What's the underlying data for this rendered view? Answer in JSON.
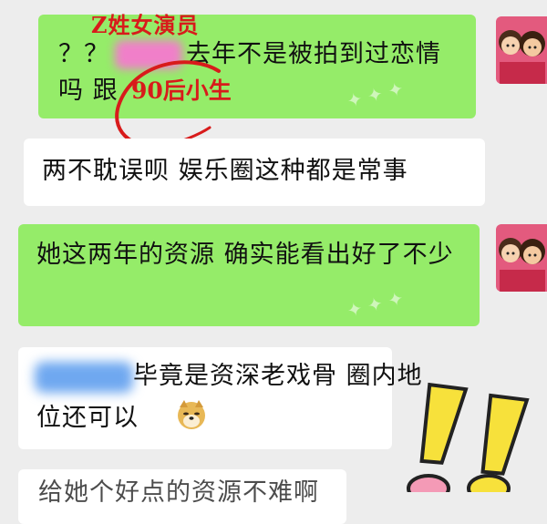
{
  "messages": [
    {
      "id": "m1",
      "side": "right",
      "color": "#95ec69",
      "line1_prefix": "？？",
      "line1_rest": "去年不是被拍到过恋情",
      "line2_prefix": "吗 跟",
      "annotation_title": "Z姓女演员",
      "annotation_highlight": "90后小生"
    },
    {
      "id": "m2",
      "side": "left",
      "color": "#ffffff",
      "text": "两不耽误呗 娱乐圈这种都是常事"
    },
    {
      "id": "m3",
      "side": "right",
      "color": "#95ec69",
      "text": "她这两年的资源 确实能看出好了不少"
    },
    {
      "id": "m4",
      "side": "left",
      "color": "#ffffff",
      "line1": "毕竟是资深老戏骨 圈内地",
      "line2": "位还可以"
    },
    {
      "id": "m5",
      "side": "left",
      "color": "#ffffff",
      "text": "给她个好点的资源不难啊"
    }
  ],
  "accent_red": "#d81b1b",
  "icons": [
    "avatar-cartoon",
    "doge-emoji",
    "exclamation-sticker"
  ]
}
